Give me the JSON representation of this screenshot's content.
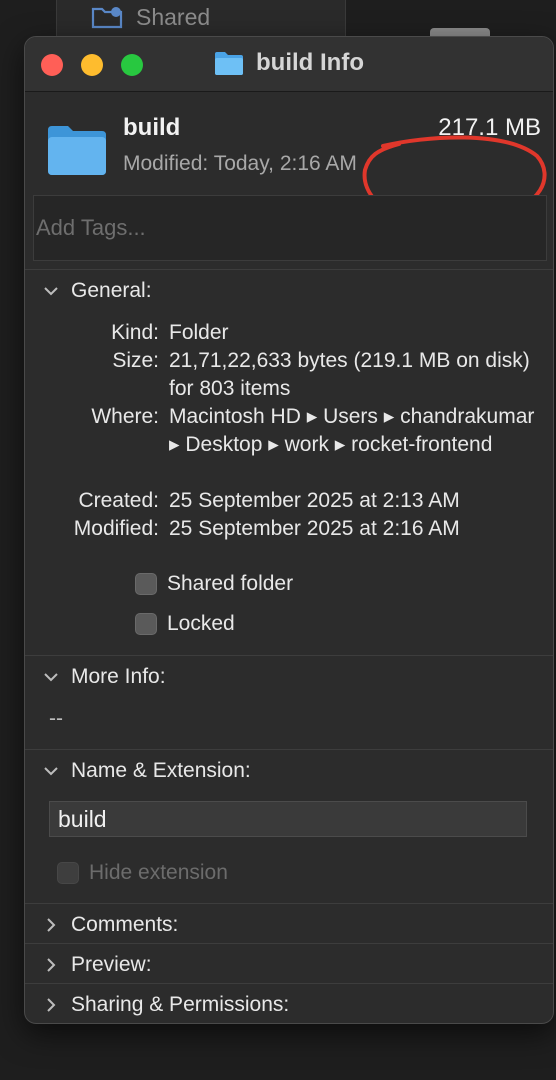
{
  "background": {
    "sidebar_item": "Shared",
    "sidebar_icon": "folder-badge-icon"
  },
  "window": {
    "title": "build Info",
    "title_icon": "folder-icon",
    "traffic_lights": {
      "close": "#ff5f57",
      "minimize": "#febc2e",
      "maximize": "#28c840"
    }
  },
  "header": {
    "name": "build",
    "size": "217.1 MB",
    "modified_label": "Modified:",
    "modified_value": "Today, 2:16 AM",
    "annotation_color": "#e0372b"
  },
  "tags": {
    "placeholder": "Add Tags..."
  },
  "general": {
    "title": "General:",
    "kind_label": "Kind:",
    "kind_value": "Folder",
    "size_label": "Size:",
    "size_value": "21,71,22,633 bytes (219.1 MB on disk) for 803 items",
    "where_label": "Where:",
    "where_value": "Macintosh HD ▸ Users ▸ chandrakumar ▸ Desktop ▸ work ▸ rocket-frontend",
    "created_label": "Created:",
    "created_value": "25 September 2025 at 2:13 AM",
    "modified_label": "Modified:",
    "modified_value": "25 September 2025 at 2:16 AM",
    "shared_folder": "Shared folder",
    "locked": "Locked"
  },
  "more_info": {
    "title": "More Info:",
    "value": "--"
  },
  "name_ext": {
    "title": "Name & Extension:",
    "field_value": "build",
    "hide_extension": "Hide extension"
  },
  "collapsed": {
    "comments": "Comments:",
    "preview": "Preview:",
    "sharing": "Sharing & Permissions:"
  }
}
